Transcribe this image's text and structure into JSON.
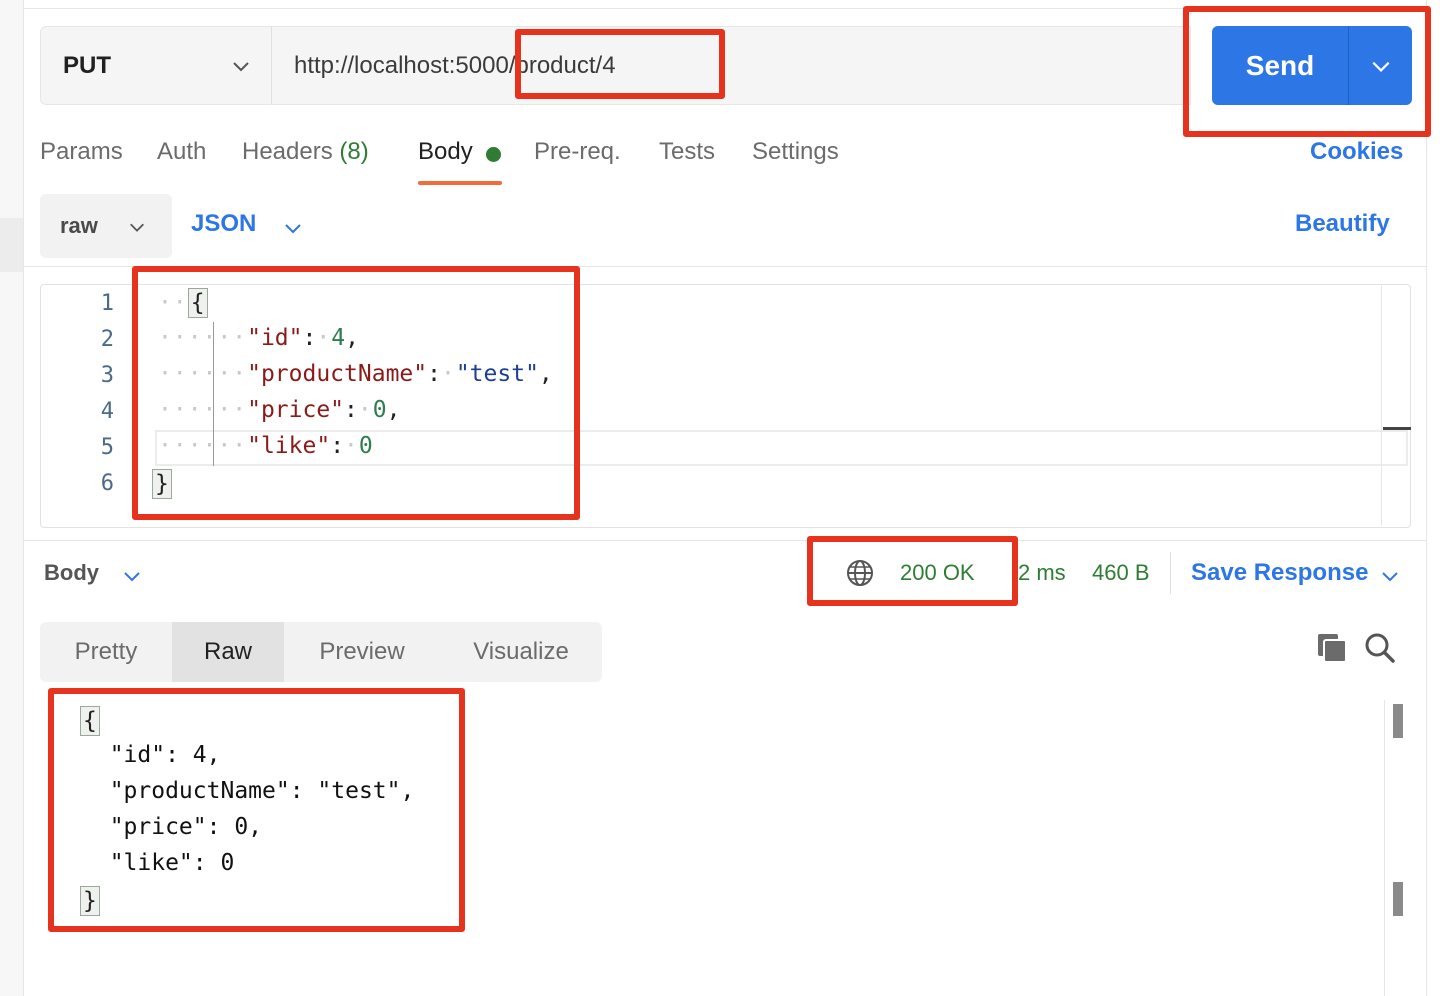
{
  "request": {
    "method": "PUT",
    "url": "http://localhost:5000/product/4",
    "send_label": "Send"
  },
  "tabs": [
    {
      "label": "Params"
    },
    {
      "label": "Auth"
    },
    {
      "label": "Headers",
      "count": "(8)"
    },
    {
      "label": "Body",
      "active": true
    },
    {
      "label": "Pre-req."
    },
    {
      "label": "Tests"
    },
    {
      "label": "Settings"
    }
  ],
  "cookies_label": "Cookies",
  "body_options": {
    "mode": "raw",
    "language": "JSON",
    "beautify_label": "Beautify"
  },
  "editor": {
    "line_numbers": [
      "1",
      "2",
      "3",
      "4",
      "5",
      "6"
    ],
    "open_brace": "{",
    "close_brace": "}",
    "fields": [
      {
        "key": "\"id\"",
        "value": "4",
        "type": "number",
        "comma": ","
      },
      {
        "key": "\"productName\"",
        "value": "\"test\"",
        "type": "string",
        "comma": ","
      },
      {
        "key": "\"price\"",
        "value": "0",
        "type": "number",
        "comma": ","
      },
      {
        "key": "\"like\"",
        "value": "0",
        "type": "number",
        "comma": ""
      }
    ]
  },
  "response": {
    "section_label": "Body",
    "status": "200 OK",
    "time": "2 ms",
    "size": "460 B",
    "save_label": "Save Response",
    "view_tabs": [
      {
        "label": "Pretty"
      },
      {
        "label": "Raw",
        "active": true
      },
      {
        "label": "Preview"
      },
      {
        "label": "Visualize"
      }
    ],
    "lines": [
      "{",
      "  \"id\": 4,",
      "  \"productName\": \"test\",",
      "  \"price\": 0,",
      "  \"like\": 0",
      "}"
    ]
  },
  "colors": {
    "accent": "#2d76e5",
    "success": "#2e7d32",
    "tab_underline": "#f26b3a",
    "annotation": "#e5331d"
  }
}
